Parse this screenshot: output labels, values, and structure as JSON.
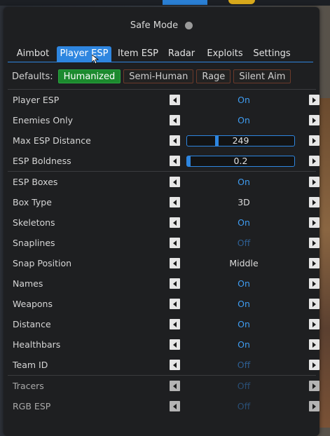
{
  "safe_mode": {
    "label": "Safe Mode",
    "enabled": false
  },
  "tabs": [
    {
      "label": "Aimbot",
      "active": false
    },
    {
      "label": "Player ESP",
      "active": true
    },
    {
      "label": "Item ESP",
      "active": false
    },
    {
      "label": "Radar",
      "active": false
    },
    {
      "label": "Exploits",
      "active": false
    },
    {
      "label": "Settings",
      "active": false
    }
  ],
  "defaults": {
    "label": "Defaults:",
    "presets": [
      {
        "label": "Humanized",
        "active": true
      },
      {
        "label": "Semi-Human",
        "active": false
      },
      {
        "label": "Rage",
        "active": false
      },
      {
        "label": "Silent Aim",
        "active": false
      }
    ]
  },
  "settings": {
    "group1": [
      {
        "label": "Player ESP",
        "value": "On",
        "state": "on"
      },
      {
        "label": "Enemies Only",
        "value": "On",
        "state": "on"
      },
      {
        "label": "Max ESP Distance",
        "value": "249",
        "slider_fraction": 0.27
      },
      {
        "label": "ESP Boldness",
        "value": "0.2",
        "slider_fraction": 0.0
      }
    ],
    "group2": [
      {
        "label": "ESP Boxes",
        "value": "On",
        "state": "on"
      },
      {
        "label": "Box Type",
        "value": "3D",
        "state": "text"
      },
      {
        "label": "Skeletons",
        "value": "On",
        "state": "on"
      },
      {
        "label": "Snaplines",
        "value": "Off",
        "state": "off"
      },
      {
        "label": "Snap Position",
        "value": "Middle",
        "state": "text"
      },
      {
        "label": "Names",
        "value": "On",
        "state": "on"
      },
      {
        "label": "Weapons",
        "value": "On",
        "state": "on"
      },
      {
        "label": "Distance",
        "value": "On",
        "state": "on"
      },
      {
        "label": "Healthbars",
        "value": "On",
        "state": "on"
      },
      {
        "label": "Team ID",
        "value": "Off",
        "state": "off"
      }
    ],
    "group3": [
      {
        "label": "Tracers",
        "value": "Off",
        "state": "off"
      },
      {
        "label": "RGB ESP",
        "value": "Off",
        "state": "off"
      }
    ]
  },
  "colors": {
    "accent": "#2e86e0",
    "on_text": "#3f9cf0",
    "off_text": "#2f5f92",
    "preset_active": "#1c8a2e"
  }
}
